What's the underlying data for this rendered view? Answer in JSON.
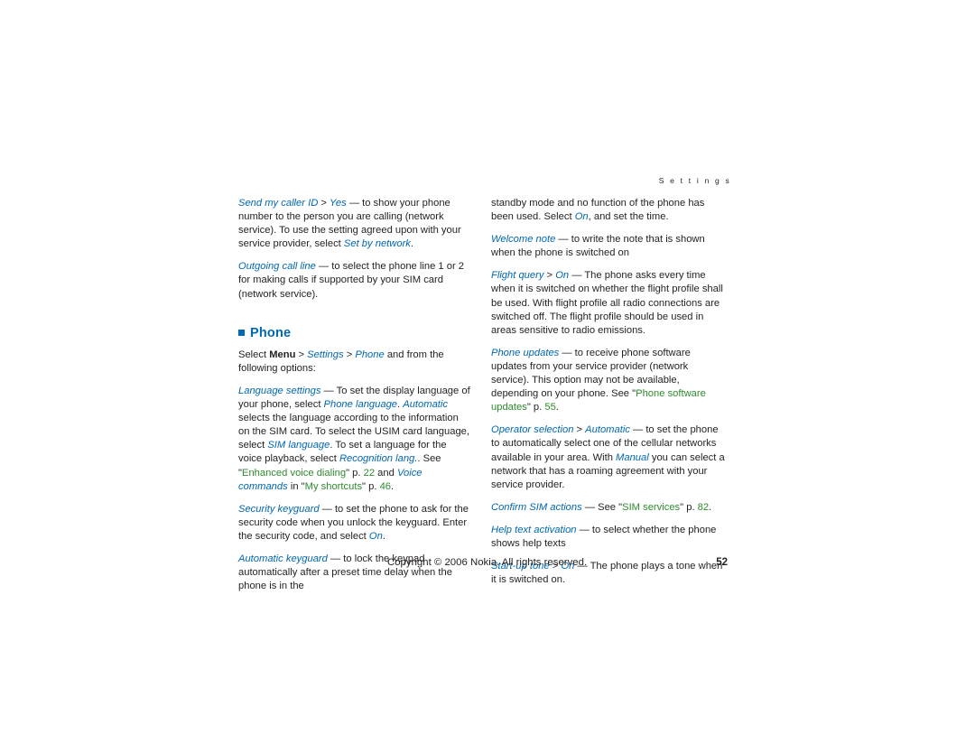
{
  "page": {
    "running_head": "S e t t i n g s",
    "page_number": "52",
    "copyright": "Copyright © 2006 Nokia. All rights reserved."
  },
  "left_column": {
    "paragraphs": [
      {
        "id": "send-my-caller-id",
        "runs": [
          {
            "text": "Send my caller ID",
            "style": "blue-italic"
          },
          {
            "text": " > ",
            "style": "plain"
          },
          {
            "text": "Yes",
            "style": "blue-italic"
          },
          {
            "text": " — to show your phone number to the person you are calling (network service). To use the setting agreed upon with your service provider, select ",
            "style": "plain"
          },
          {
            "text": "Set by network",
            "style": "blue-italic"
          },
          {
            "text": ".",
            "style": "plain"
          }
        ]
      },
      {
        "id": "outgoing-call-line",
        "runs": [
          {
            "text": "Outgoing call line",
            "style": "blue-italic"
          },
          {
            "text": " — to select the phone line 1 or 2 for making calls if supported by your SIM card (network service).",
            "style": "plain"
          }
        ]
      }
    ],
    "section_heading": "Phone",
    "intro": {
      "runs": [
        {
          "text": "Select ",
          "style": "plain"
        },
        {
          "text": "Menu",
          "style": "bold"
        },
        {
          "text": " > ",
          "style": "plain"
        },
        {
          "text": "Settings",
          "style": "blue-italic"
        },
        {
          "text": " > ",
          "style": "plain"
        },
        {
          "text": "Phone",
          "style": "blue-italic"
        },
        {
          "text": " and from the following options:",
          "style": "plain"
        }
      ]
    },
    "options": [
      {
        "id": "language-settings",
        "runs": [
          {
            "text": "Language settings",
            "style": "blue-italic"
          },
          {
            "text": " — To set the display language of your phone, select ",
            "style": "plain"
          },
          {
            "text": "Phone language",
            "style": "blue-italic"
          },
          {
            "text": ". ",
            "style": "plain"
          },
          {
            "text": "Automatic",
            "style": "blue-italic"
          },
          {
            "text": " selects the language according to the information on the SIM card. To select the USIM card language, select ",
            "style": "plain"
          },
          {
            "text": "SIM language",
            "style": "blue-italic"
          },
          {
            "text": ". To set a language for the voice playback, select ",
            "style": "plain"
          },
          {
            "text": "Recognition lang.",
            "style": "blue-italic"
          },
          {
            "text": ". See \"",
            "style": "plain"
          },
          {
            "text": "Enhanced voice dialing",
            "style": "green"
          },
          {
            "text": "\" p. ",
            "style": "plain"
          },
          {
            "text": "22",
            "style": "green"
          },
          {
            "text": " and ",
            "style": "plain"
          },
          {
            "text": "Voice commands",
            "style": "blue-italic"
          },
          {
            "text": " in \"",
            "style": "plain"
          },
          {
            "text": "My shortcuts",
            "style": "green"
          },
          {
            "text": "\" p. ",
            "style": "plain"
          },
          {
            "text": "46",
            "style": "green"
          },
          {
            "text": ".",
            "style": "plain"
          }
        ]
      },
      {
        "id": "security-keyguard",
        "runs": [
          {
            "text": "Security keyguard",
            "style": "blue-italic"
          },
          {
            "text": " — to set the phone to ask for the security code when you unlock the keyguard. Enter the security code, and select ",
            "style": "plain"
          },
          {
            "text": "On",
            "style": "blue-italic"
          },
          {
            "text": ".",
            "style": "plain"
          }
        ]
      },
      {
        "id": "automatic-keyguard",
        "runs": [
          {
            "text": "Automatic keyguard",
            "style": "blue-italic"
          },
          {
            "text": " — to lock the keypad automatically after a preset time delay when the phone is in the",
            "style": "plain"
          }
        ]
      }
    ]
  },
  "right_column": {
    "paragraphs": [
      {
        "id": "standby-continuation",
        "runs": [
          {
            "text": "standby mode and no function of the phone has been used. Select ",
            "style": "plain"
          },
          {
            "text": "On",
            "style": "blue-italic"
          },
          {
            "text": ", and set the time.",
            "style": "plain"
          }
        ]
      },
      {
        "id": "welcome-note",
        "runs": [
          {
            "text": "Welcome note",
            "style": "blue-italic"
          },
          {
            "text": " — to write the note that is shown when the phone is switched on",
            "style": "plain"
          }
        ]
      },
      {
        "id": "flight-query",
        "runs": [
          {
            "text": "Flight query",
            "style": "blue-italic"
          },
          {
            "text": " > ",
            "style": "plain"
          },
          {
            "text": "On",
            "style": "blue-italic"
          },
          {
            "text": " — The phone asks every time when it is switched on whether the flight profile shall be used. With flight profile all radio connections are switched off. The flight profile should be used in areas sensitive to radio emissions.",
            "style": "plain"
          }
        ]
      },
      {
        "id": "phone-updates",
        "runs": [
          {
            "text": "Phone updates",
            "style": "blue-italic"
          },
          {
            "text": " — to receive phone software updates from your service provider (network service). This option may not be available, depending on your phone. See \"",
            "style": "plain"
          },
          {
            "text": "Phone software updates",
            "style": "green"
          },
          {
            "text": "\" p. ",
            "style": "plain"
          },
          {
            "text": "55",
            "style": "green"
          },
          {
            "text": ".",
            "style": "plain"
          }
        ]
      },
      {
        "id": "operator-selection",
        "runs": [
          {
            "text": "Operator selection",
            "style": "blue-italic"
          },
          {
            "text": " > ",
            "style": "plain"
          },
          {
            "text": "Automatic",
            "style": "blue-italic"
          },
          {
            "text": " — to set the phone to automatically select one of the cellular networks available in your area. With ",
            "style": "plain"
          },
          {
            "text": "Manual",
            "style": "blue-italic"
          },
          {
            "text": " you can select a network that has a roaming agreement with your service provider.",
            "style": "plain"
          }
        ]
      },
      {
        "id": "confirm-sim-actions",
        "runs": [
          {
            "text": "Confirm SIM actions",
            "style": "blue-italic"
          },
          {
            "text": " — See \"",
            "style": "plain"
          },
          {
            "text": "SIM services",
            "style": "green"
          },
          {
            "text": "\" p. ",
            "style": "plain"
          },
          {
            "text": "82",
            "style": "green"
          },
          {
            "text": ".",
            "style": "plain"
          }
        ]
      },
      {
        "id": "help-text-activation",
        "runs": [
          {
            "text": "Help text activation",
            "style": "blue-italic"
          },
          {
            "text": " — to select whether the phone shows help texts",
            "style": "plain"
          }
        ]
      },
      {
        "id": "start-up-tone",
        "runs": [
          {
            "text": "Start-up tone",
            "style": "blue-italic"
          },
          {
            "text": " > ",
            "style": "plain"
          },
          {
            "text": "On",
            "style": "blue-italic"
          },
          {
            "text": " — The phone plays a tone when it is switched on.",
            "style": "plain"
          }
        ]
      }
    ]
  }
}
